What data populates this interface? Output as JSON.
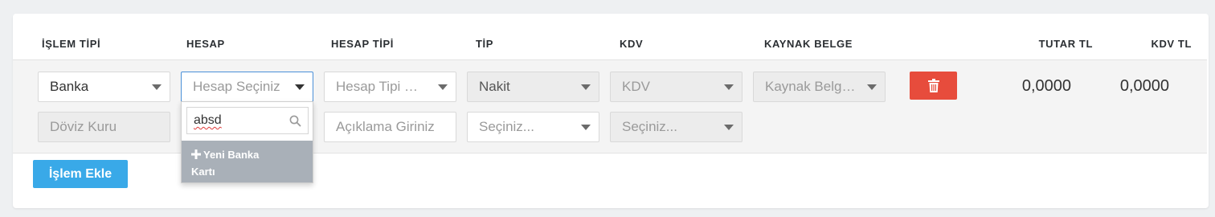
{
  "headers": {
    "islem_tipi": "İŞLEM TİPİ",
    "hesap": "HESAP",
    "hesap_tipi": "HESAP TİPİ",
    "tip": "TİP",
    "kdv": "KDV",
    "kaynak_belge": "KAYNAK BELGE",
    "tutar_tl": "TUTAR TL",
    "kdv_tl": "KDV TL"
  },
  "row1": {
    "islem_tipi_value": "Banka",
    "hesap_placeholder": "Hesap Seçiniz",
    "hesap_tipi_placeholder": "Hesap Tipi Seç...",
    "tip_value": "Nakit",
    "kdv_placeholder": "KDV",
    "kaynak_belge_placeholder": "Kaynak Belge ...",
    "tutar": "0,0000",
    "kdv_tutar": "0,0000"
  },
  "row2": {
    "doviz_kuru_placeholder": "Döviz Kuru",
    "aciklama_placeholder": "Açıklama Giriniz",
    "select1_placeholder": "Seçiniz...",
    "select2_placeholder": "Seçiniz..."
  },
  "dropdown": {
    "search_value": "absd",
    "new_item_label": "Yeni Banka Kartı",
    "new_item_line1": "Yeni Banka",
    "new_item_line2": "Kartı"
  },
  "actions": {
    "add_button": "İşlem Ekle",
    "delete_icon": "trash-icon"
  },
  "colors": {
    "delete_button": "#e74c3c",
    "add_button": "#39a9e8",
    "dropdown_item": "#a9b0b8",
    "active_border": "#4a90d9"
  }
}
